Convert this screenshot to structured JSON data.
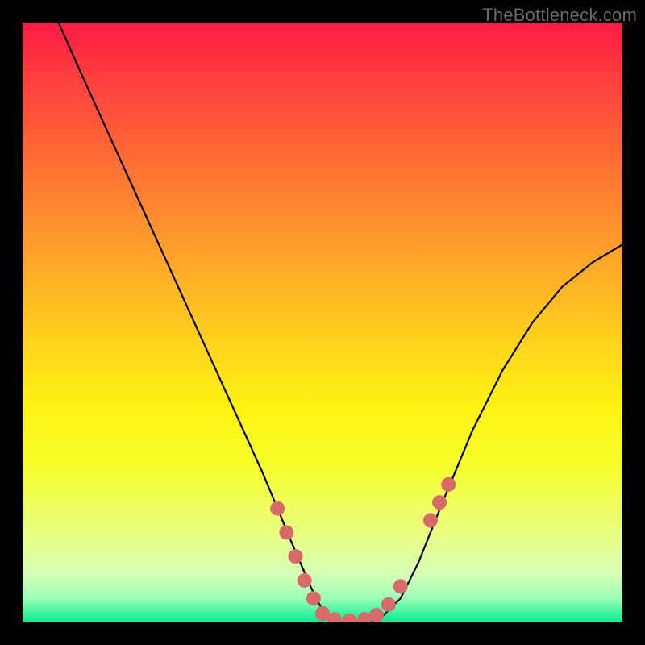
{
  "watermark": "TheBottleneck.com",
  "chart_data": {
    "type": "line",
    "title": "",
    "xlabel": "",
    "ylabel": "",
    "xlim": [
      0,
      100
    ],
    "ylim": [
      0,
      100
    ],
    "series": [
      {
        "name": "curve",
        "x": [
          6,
          10,
          15,
          20,
          25,
          30,
          35,
          40,
          45,
          48,
          50,
          52,
          55,
          58,
          60,
          63,
          66,
          70,
          75,
          80,
          85,
          90,
          95,
          100
        ],
        "y": [
          100,
          91,
          80,
          69,
          58,
          47,
          36,
          25,
          13,
          6,
          2,
          0,
          0,
          0,
          1,
          4,
          10,
          20,
          32,
          42,
          50,
          56,
          60,
          63
        ]
      }
    ],
    "markers": [
      {
        "x": 42.5,
        "y": 19
      },
      {
        "x": 44.0,
        "y": 15
      },
      {
        "x": 45.5,
        "y": 11
      },
      {
        "x": 47.0,
        "y": 7
      },
      {
        "x": 48.5,
        "y": 4
      },
      {
        "x": 50.0,
        "y": 1.5
      },
      {
        "x": 52.0,
        "y": 0.5
      },
      {
        "x": 54.5,
        "y": 0.3
      },
      {
        "x": 57.0,
        "y": 0.5
      },
      {
        "x": 59.0,
        "y": 1.2
      },
      {
        "x": 61.0,
        "y": 3
      },
      {
        "x": 63.0,
        "y": 6
      },
      {
        "x": 68.0,
        "y": 17
      },
      {
        "x": 69.5,
        "y": 20
      },
      {
        "x": 71.0,
        "y": 23
      }
    ],
    "colors": {
      "curve": "#000000",
      "marker": "#d96a6a"
    }
  }
}
